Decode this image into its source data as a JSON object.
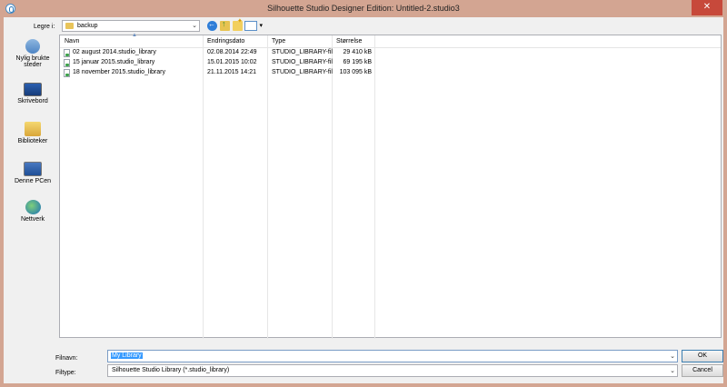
{
  "window": {
    "title": "Silhouette Studio Designer Edition: Untitled-2.studio3",
    "close_glyph": "✕"
  },
  "toolbar": {
    "look_in_label": "Legre i:",
    "look_in_value": "backup"
  },
  "places": [
    {
      "label": "Nylig brukte steder",
      "icon": "recent-places-icon"
    },
    {
      "label": "Skrivebord",
      "icon": "desktop-icon"
    },
    {
      "label": "Biblioteker",
      "icon": "libraries-icon"
    },
    {
      "label": "Denne PCen",
      "icon": "computer-icon"
    },
    {
      "label": "Nettverk",
      "icon": "network-icon"
    }
  ],
  "columns": {
    "name": "Navn",
    "date": "Endringsdato",
    "type": "Type",
    "size": "Størrelse"
  },
  "files": [
    {
      "name": "02 august 2014.studio_library",
      "date": "02.08.2014 22:49",
      "type": "STUDIO_LIBRARY-fil",
      "size": "29 410 kB"
    },
    {
      "name": "15 januar 2015.studio_library",
      "date": "15.01.2015 10:02",
      "type": "STUDIO_LIBRARY-fil",
      "size": "69 195 kB"
    },
    {
      "name": "18 november 2015.studio_library",
      "date": "21.11.2015 14:21",
      "type": "STUDIO_LIBRARY-fil",
      "size": "103 095 kB"
    }
  ],
  "bottom": {
    "filename_label": "Filnavn:",
    "filename_value": "My Library",
    "filetype_label": "Filtype:",
    "filetype_value": "Silhouette Studio Library (*.studio_library)",
    "ok_label": "OK",
    "cancel_label": "Cancel"
  },
  "colors": {
    "window_frame": "#d3a592",
    "close_button": "#c7493b",
    "selection": "#3399ff"
  }
}
